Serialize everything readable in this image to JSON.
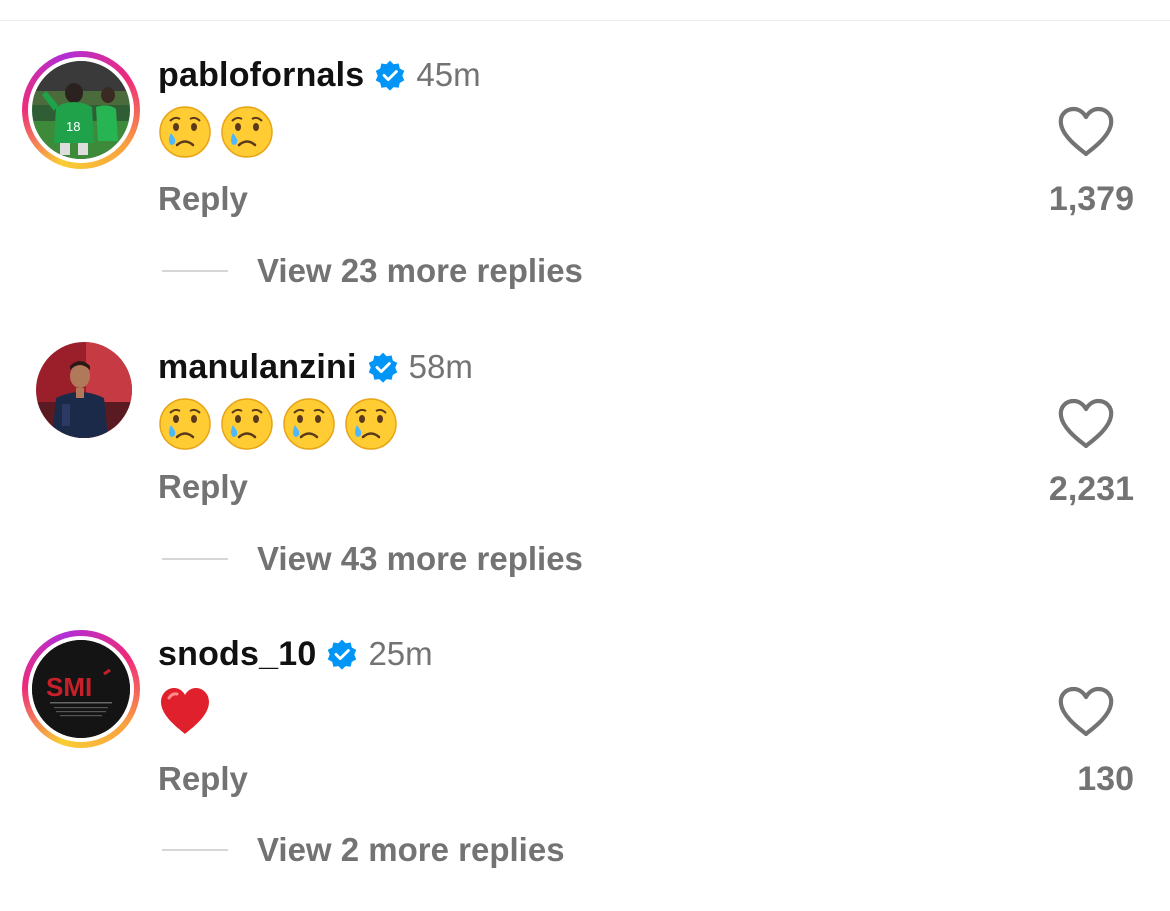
{
  "comments": [
    {
      "username": "pablofornals",
      "verified": true,
      "time": "45m",
      "emoji": [
        "crying-face",
        "crying-face"
      ],
      "reply_label": "Reply",
      "likes": "1,379",
      "view_replies": "View 23 more replies",
      "has_story_ring": true
    },
    {
      "username": "manulanzini",
      "verified": true,
      "time": "58m",
      "emoji": [
        "crying-face",
        "crying-face",
        "crying-face",
        "crying-face"
      ],
      "reply_label": "Reply",
      "likes": "2,231",
      "view_replies": "View 43 more replies",
      "has_story_ring": false
    },
    {
      "username": "snods_10",
      "verified": true,
      "time": "25m",
      "emoji": [
        "red-heart"
      ],
      "reply_label": "Reply",
      "likes": "130",
      "view_replies": "View 2 more replies",
      "has_story_ring": true
    }
  ],
  "avatar3_logo": "SMI",
  "colors": {
    "verified_blue": "#0095f6",
    "meta_gray": "#737373",
    "username": "#111111"
  }
}
